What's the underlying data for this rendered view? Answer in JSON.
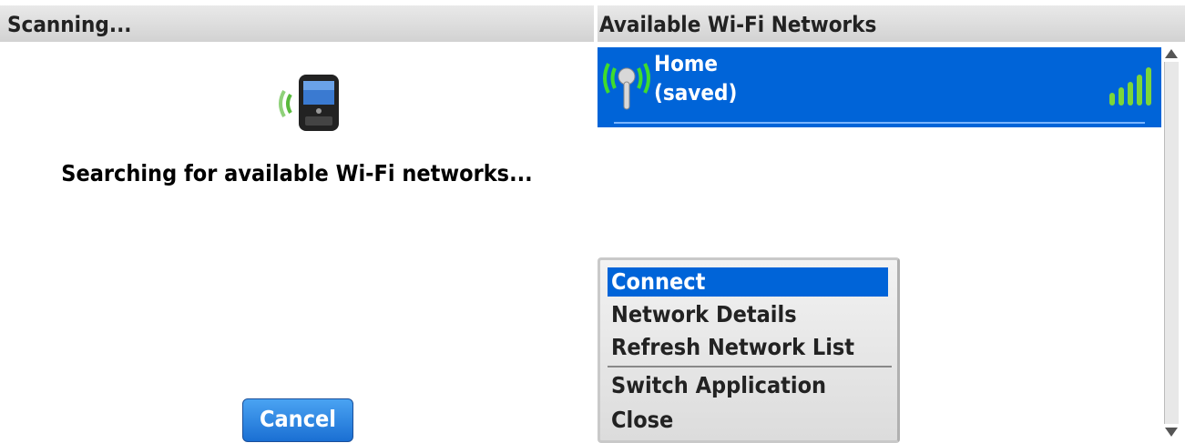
{
  "left_screen": {
    "title": "Scanning...",
    "message": "Searching for available Wi-Fi networks...",
    "cancel_label": "Cancel",
    "icon": "phone-scanning-icon"
  },
  "right_screen": {
    "title": "Available Wi-Fi Networks",
    "networks": [
      {
        "name": "Home",
        "status": "(saved)",
        "icon": "wifi-antenna-icon",
        "signal_icon": "signal-strength-icon",
        "signal_bars": 5
      }
    ],
    "menu": {
      "items": [
        {
          "label": "Connect",
          "selected": true
        },
        {
          "label": "Network Details",
          "selected": false
        },
        {
          "label": "Refresh Network List",
          "selected": false
        },
        {
          "label": "Switch Application",
          "selected": false
        },
        {
          "label": "Close",
          "selected": false
        }
      ]
    }
  },
  "colors": {
    "selection": "#0064d8",
    "titlebar": "#d9d9d9",
    "wifi_green": "#3fb82d",
    "button": "#2a84e6"
  }
}
